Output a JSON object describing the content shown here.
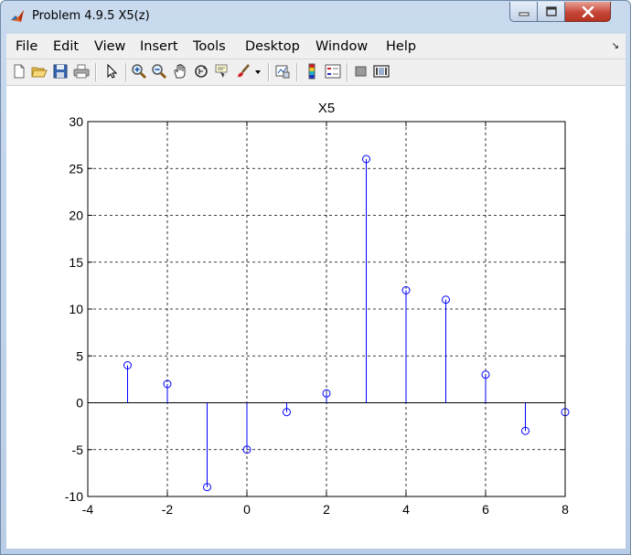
{
  "window": {
    "title": "Problem 4.9.5 X5(z)",
    "app_icon": "matlab-icon",
    "controls": [
      "minimize-icon",
      "maximize-icon",
      "close-icon"
    ]
  },
  "menubar": {
    "items": [
      "File",
      "Edit",
      "View",
      "Insert",
      "Tools",
      "Desktop",
      "Window",
      "Help"
    ],
    "overflow_glyph": "↘"
  },
  "toolbar": {
    "icons": [
      "new-figure-icon",
      "open-file-icon",
      "save-icon",
      "print-icon",
      "edit-plot-arrow-icon",
      "zoom-in-icon",
      "zoom-out-icon",
      "pan-hand-icon",
      "rotate-3d-icon",
      "data-cursor-icon",
      "brush-icon",
      "dropdown-arrow-icon",
      "link-plot-icon",
      "insert-colorbar-icon",
      "insert-legend-icon",
      "hide-plot-tools-icon",
      "show-plot-tools-icon"
    ]
  },
  "colors": {
    "stem": "#0000ff",
    "axes": "#000000",
    "grid": "#000000",
    "titlebar": "#c4d6ec",
    "close_button": "#c6473a"
  },
  "chart_data": {
    "type": "stem",
    "title": "X5",
    "xlabel": "",
    "ylabel": "",
    "xlim": [
      -4,
      8
    ],
    "ylim": [
      -10,
      30
    ],
    "xticks": [
      -4,
      -2,
      0,
      2,
      4,
      6,
      8
    ],
    "yticks": [
      -10,
      -5,
      0,
      5,
      10,
      15,
      20,
      25,
      30
    ],
    "grid": true,
    "grid_style": "dashed",
    "marker": "circle",
    "x": [
      -3,
      -2,
      -1,
      0,
      1,
      2,
      3,
      4,
      5,
      6,
      7,
      8
    ],
    "y": [
      4,
      2,
      -9,
      -5,
      -1,
      1,
      26,
      12,
      11,
      3,
      -3,
      -1
    ]
  }
}
